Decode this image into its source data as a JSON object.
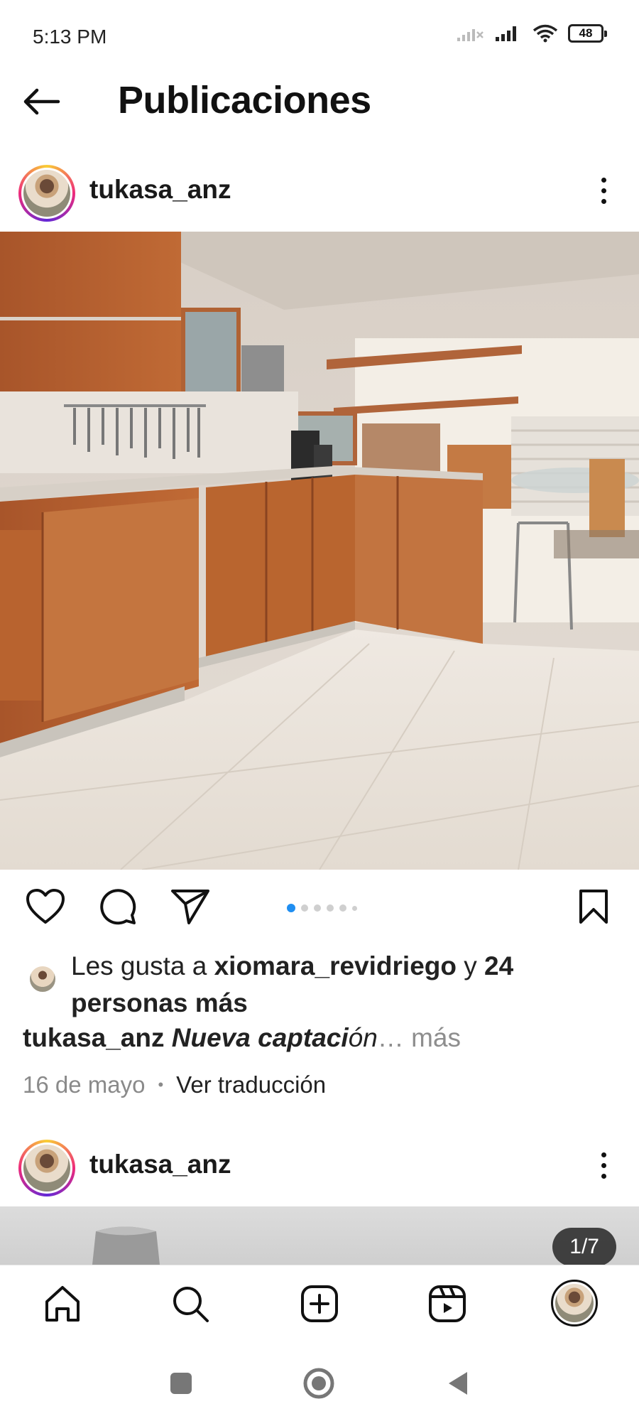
{
  "status_bar": {
    "time": "5:13 PM",
    "battery": "48",
    "icons": [
      "signal-icon",
      "signal-icon",
      "wifi-icon",
      "battery-icon"
    ]
  },
  "header": {
    "title": "Publicaciones",
    "back_icon": "arrow-left-icon"
  },
  "post1": {
    "username": "tukasa_anz",
    "likes": {
      "prefix": "Les gusta a ",
      "user": "xiomara_revidriego",
      "middle": " y ",
      "count": "24",
      "suffix": "personas más"
    },
    "caption": {
      "user": "tukasa_anz",
      "text": "Nueva captaci",
      "text_tail": "ón",
      "more": "… más"
    },
    "date": "16 de mayo",
    "separator": "•",
    "translate": "Ver traducción",
    "carousel_active": 1
  },
  "post2": {
    "username": "tukasa_anz",
    "page_indicator": "1/7"
  },
  "bottom_nav": [
    "home-icon",
    "search-icon",
    "create-icon",
    "reels-icon",
    "profile-avatar"
  ],
  "colors": {
    "accent": "#1f8ef1",
    "text": "#111111",
    "muted": "#8e8e8e"
  }
}
